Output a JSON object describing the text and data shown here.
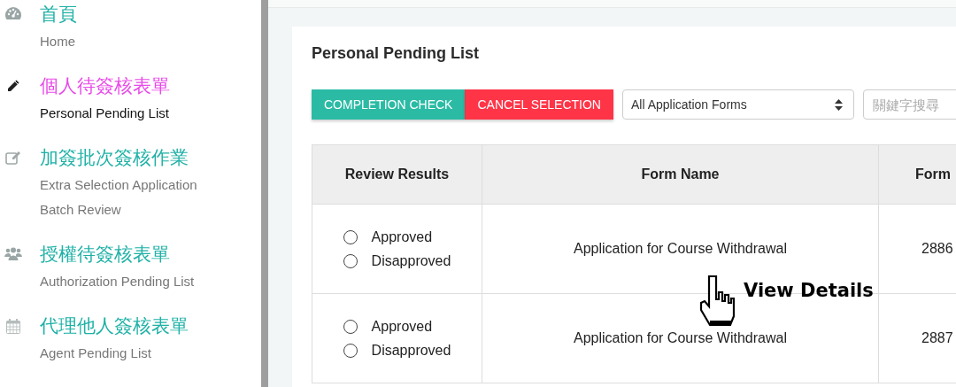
{
  "sidebar": {
    "items": [
      {
        "title": "首頁",
        "subtitle": "Home",
        "selected": false
      },
      {
        "title": "個人待簽核表單",
        "subtitle": "Personal Pending List",
        "selected": true
      },
      {
        "title": "加簽批次簽核作業",
        "subtitle": "Extra Selection Application Batch Review",
        "selected": false
      },
      {
        "title": "授權待簽核表單",
        "subtitle": "Authorization Pending List",
        "selected": false
      },
      {
        "title": "代理他人簽核表單",
        "subtitle": "Agent Pending List",
        "selected": false
      }
    ]
  },
  "card": {
    "title": "Personal Pending List"
  },
  "toolbar": {
    "buttons": [
      {
        "label": "COMPLETION CHECK",
        "kind": "primary"
      },
      {
        "label": "CANCEL SELECTION",
        "kind": "danger"
      }
    ],
    "filter": {
      "value": "All Application Forms"
    },
    "search": {
      "placeholder": "關鍵字搜尋"
    }
  },
  "table": {
    "columns": [
      "Review Results",
      "Form Name",
      "Form"
    ],
    "rows": [
      {
        "options": [
          {
            "label": "Approved",
            "selected": false
          },
          {
            "label": "Disapproved",
            "selected": false
          }
        ],
        "form_name": "Application for Course Withdrawal",
        "column_3": "2886"
      },
      {
        "options": [
          {
            "label": "Approved",
            "selected": false
          },
          {
            "label": "Disapproved",
            "selected": false
          }
        ],
        "form_name": "Application for Course Withdrawal",
        "column_3": "2887"
      }
    ]
  },
  "cursor_tooltip": {
    "text": "View Details"
  }
}
